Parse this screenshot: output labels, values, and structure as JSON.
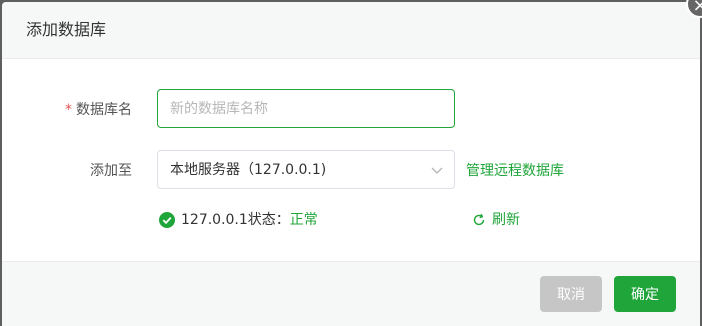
{
  "dialog": {
    "title": "添加数据库",
    "close_icon": "×"
  },
  "form": {
    "name_label": "数据库名",
    "required_mark": "*",
    "name_placeholder": "新的数据库名称",
    "name_value": "",
    "target_label": "添加至",
    "target_value": "本地服务器（127.0.0.1)",
    "manage_remote_link": "管理远程数据库",
    "status_text": "127.0.0.1状态：",
    "status_value": "正常",
    "refresh_label": "刷新"
  },
  "footer": {
    "cancel_label": "取消",
    "confirm_label": "确定"
  },
  "colors": {
    "accent": "#20a53a",
    "required": "#e55353",
    "disabled_button": "#c6c6c6"
  },
  "icons": [
    "close-icon",
    "chevron-down-icon",
    "check-circle-icon",
    "refresh-icon"
  ]
}
